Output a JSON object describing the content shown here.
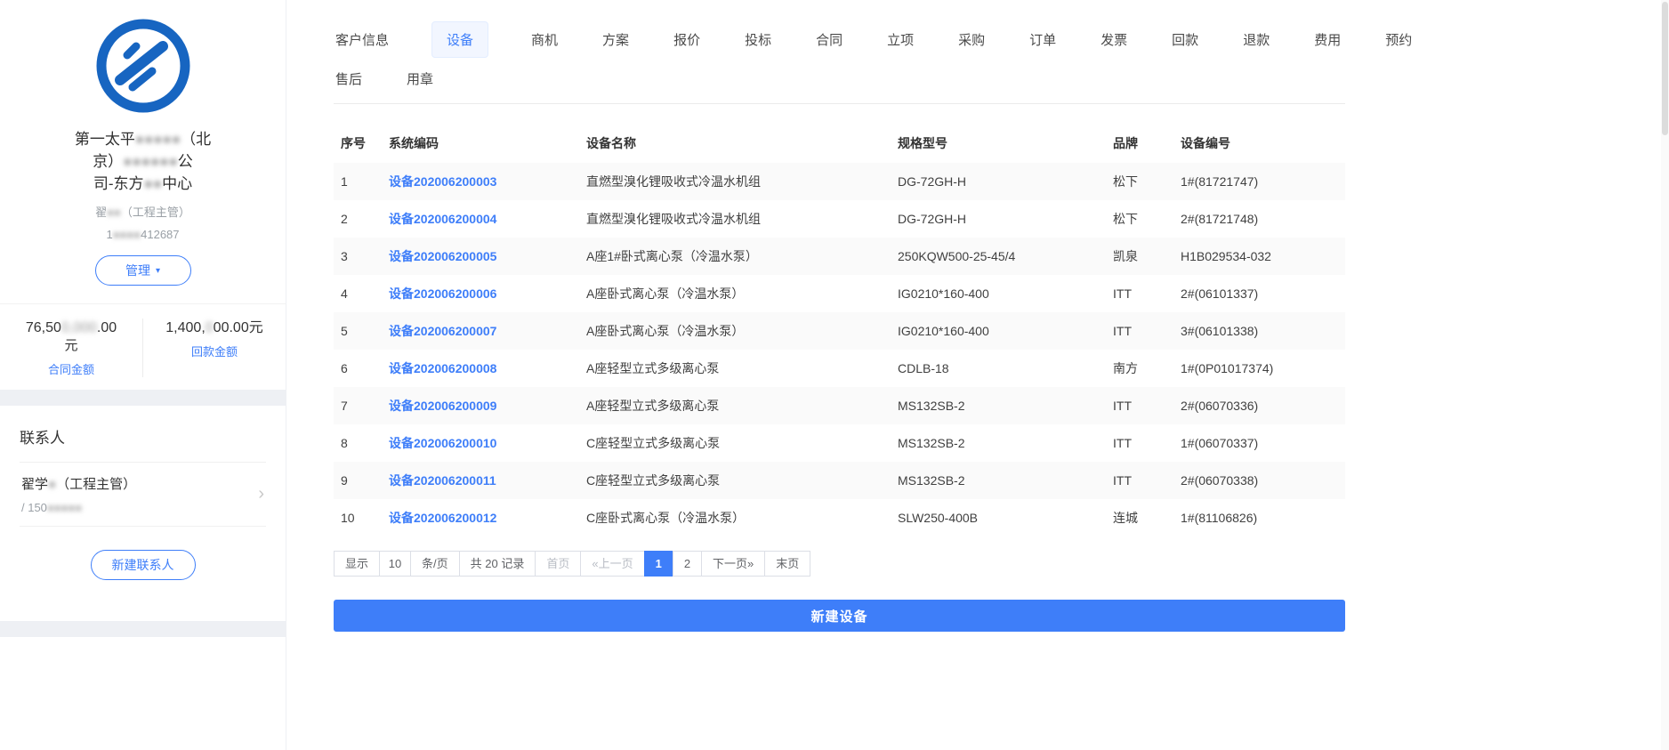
{
  "colors": {
    "accent": "#3e7ef9"
  },
  "icons": {
    "caret_down": "▾",
    "chevron_right": "›"
  },
  "sidebar": {
    "company": {
      "name": [
        {
          "pre": "第一太平",
          "red": "●●●●●",
          "post": "（北"
        },
        {
          "pre": "京）",
          "red": "●●●●●●",
          "post": "公"
        },
        {
          "pre": "司-东方",
          "red": "●●",
          "post": "中心"
        }
      ],
      "contact": {
        "pre": "翟",
        "red": "●●",
        "post": "（工程主管）"
      },
      "phone": {
        "pre": "1",
        "red": "●●●●",
        "post": "412687"
      },
      "manage_label": "管理",
      "stats": [
        {
          "pre": "76,50",
          "red": "0,000",
          "post": ".00",
          "unit": "元",
          "label": "合同金额"
        },
        {
          "pre": "1,400,",
          "red": "0",
          "post": "00.00元",
          "unit": "",
          "label": "回款金额"
        }
      ]
    },
    "contacts": {
      "title": "联系人",
      "items": [
        {
          "name_pre": "翟学",
          "name_red": "●",
          "name_post": "（工程主管）",
          "phone_pre": "/ 150",
          "phone_red": "●●●●●",
          "phone_post": ""
        }
      ],
      "new_button": "新建联系人"
    }
  },
  "tabs": {
    "active": "设备",
    "row1": [
      "客户信息",
      "设备",
      "商机",
      "方案",
      "报价",
      "投标",
      "合同",
      "立项",
      "采购",
      "订单",
      "发票",
      "回款",
      "退款",
      "费用",
      "预约"
    ],
    "row2": [
      "售后",
      "用章"
    ]
  },
  "table": {
    "headers": [
      "序号",
      "系统编码",
      "设备名称",
      "规格型号",
      "品牌",
      "设备编号"
    ],
    "rows": [
      [
        "1",
        "设备202006200003",
        "直燃型溴化锂吸收式冷温水机组",
        "DG-72GH-H",
        "松下",
        "1#(81721747)"
      ],
      [
        "2",
        "设备202006200004",
        "直燃型溴化锂吸收式冷温水机组",
        "DG-72GH-H",
        "松下",
        "2#(81721748)"
      ],
      [
        "3",
        "设备202006200005",
        "A座1#卧式离心泵（冷温水泵）",
        "250KQW500-25-45/4",
        "凯泉",
        "H1B029534-032"
      ],
      [
        "4",
        "设备202006200006",
        "A座卧式离心泵（冷温水泵）",
        "IG0210*160-400",
        "ITT",
        "2#(06101337)"
      ],
      [
        "5",
        "设备202006200007",
        "A座卧式离心泵（冷温水泵）",
        "IG0210*160-400",
        "ITT",
        "3#(06101338)"
      ],
      [
        "6",
        "设备202006200008",
        "A座轻型立式多级离心泵",
        "CDLB-18",
        "南方",
        "1#(0P01017374)"
      ],
      [
        "7",
        "设备202006200009",
        "A座轻型立式多级离心泵",
        "MS132SB-2",
        "ITT",
        "2#(06070336)"
      ],
      [
        "8",
        "设备202006200010",
        "C座轻型立式多级离心泵",
        "MS132SB-2",
        "ITT",
        "1#(06070337)"
      ],
      [
        "9",
        "设备202006200011",
        "C座轻型立式多级离心泵",
        "MS132SB-2",
        "ITT",
        "2#(06070338)"
      ],
      [
        "10",
        "设备202006200012",
        "C座卧式离心泵（冷温水泵）",
        "SLW250-400B",
        "连城",
        "1#(81106826)"
      ]
    ]
  },
  "pagination": {
    "show_label": "显示",
    "page_size": "10",
    "per_page_label": "条/页",
    "total_label": "共 20 记录",
    "first": "首页",
    "prev": "«上一页",
    "pages": [
      "1",
      "2"
    ],
    "active_page": "1",
    "next": "下一页»",
    "last": "末页"
  },
  "footer": {
    "new_device_button": "新建设备"
  }
}
